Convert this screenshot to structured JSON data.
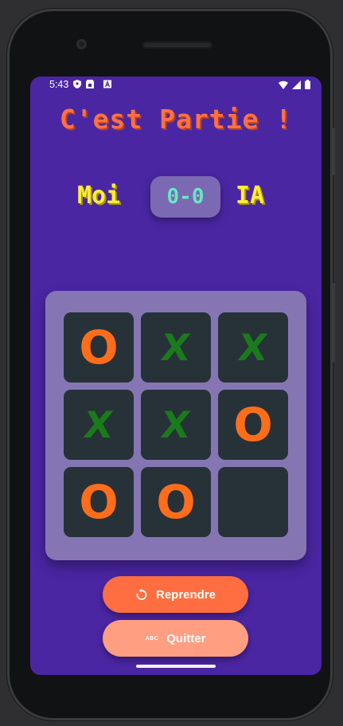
{
  "status_bar": {
    "time": "5:43",
    "left_icons": [
      "shield-icon",
      "sim-card-icon",
      "font-a-icon"
    ],
    "right_icons": [
      "wifi-icon",
      "signal-icon",
      "battery-icon"
    ]
  },
  "title": "C'est Partie !",
  "score": {
    "player_label": "Moi",
    "score_text": "0-0",
    "opponent_label": "IA"
  },
  "board": {
    "cells": [
      "O",
      "X",
      "X",
      "X",
      "X",
      "O",
      "O",
      "O",
      ""
    ]
  },
  "buttons": {
    "resume_label": "Reprendre",
    "quit_label": "Quitter",
    "quit_icon_text": "ABC"
  },
  "colors": {
    "background": "#4a26a3",
    "title": "#ff7043",
    "player_labels": "#ffeb3b",
    "score": "#67e8c4",
    "o_mark": "#ff6d1a",
    "x_mark": "#1b7a1b",
    "cell": "#263238",
    "resume_button": "#ff6e40",
    "quit_button": "#ff9e80"
  }
}
